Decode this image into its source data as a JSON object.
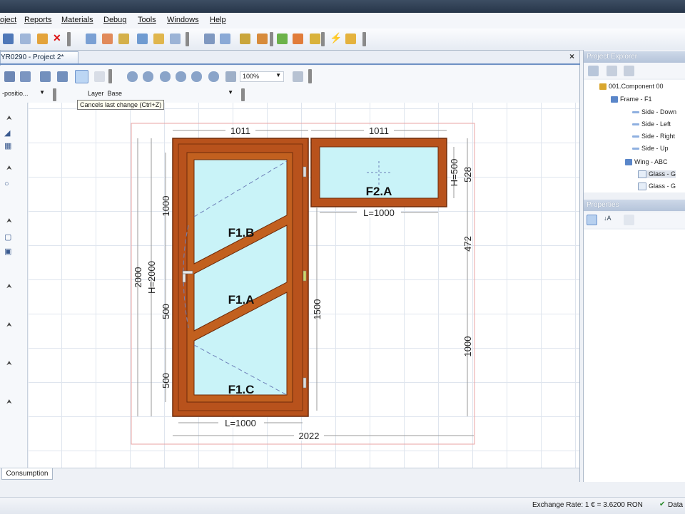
{
  "menu": {
    "items": [
      "oject",
      "Reports",
      "Materials",
      "Debug",
      "Tools",
      "Windows",
      "Help"
    ]
  },
  "document": {
    "tab_title": "YR0290 - Project 2*",
    "close_symbol": "×"
  },
  "view_toolbar": {
    "zoom": "100%"
  },
  "layer_bar": {
    "position_label": "-positio...",
    "layer_label": "Layer",
    "layer_value": "Base"
  },
  "tooltip": "Cancels last change (Ctrl+Z)",
  "drawing": {
    "labels": {
      "f1b": "F1.B",
      "f1a": "F1.A",
      "f1c": "F1.C",
      "f2a": "F2.A"
    },
    "dimensions": {
      "top_left": "1011",
      "top_right": "1011",
      "f2a_width": "L=1000",
      "f2a_height": "H=500",
      "right_top": "528",
      "right_mid": "472",
      "right_bottom": "1000",
      "left_overall": "2000",
      "left_frame": "H=2000",
      "left_upper": "1000",
      "left_middle": "500",
      "left_lower": "500",
      "inner_vertical": "1500",
      "bottom_frame": "L=1000",
      "bottom_overall": "2022"
    },
    "colors": {
      "frame": "#b8521c",
      "frame_dark": "#6e2b0a",
      "glass": "#c9f3f8",
      "outline": "#e9a3a3"
    }
  },
  "bottom_tabs": {
    "consumption": "Consumption"
  },
  "project_explorer": {
    "title": "Project Explorer",
    "tree": [
      {
        "label": "001.Component 00",
        "icon": "component-icon"
      },
      {
        "label": "Frame - F1",
        "icon": "frame-icon"
      },
      {
        "label": "Side - Down",
        "icon": "side-icon"
      },
      {
        "label": "Side - Left",
        "icon": "side-icon"
      },
      {
        "label": "Side - Right",
        "icon": "side-icon"
      },
      {
        "label": "Side - Up",
        "icon": "side-icon"
      },
      {
        "label": "Wing - ABC",
        "icon": "wing-icon"
      },
      {
        "label": "Glass - G",
        "icon": "glass-icon"
      },
      {
        "label": "Glass - G",
        "icon": "glass-icon"
      }
    ]
  },
  "properties": {
    "title": "Properties"
  },
  "status": {
    "exchange_rate": "Exchange Rate: 1 € = 3.6200 RON",
    "data": "Data"
  }
}
